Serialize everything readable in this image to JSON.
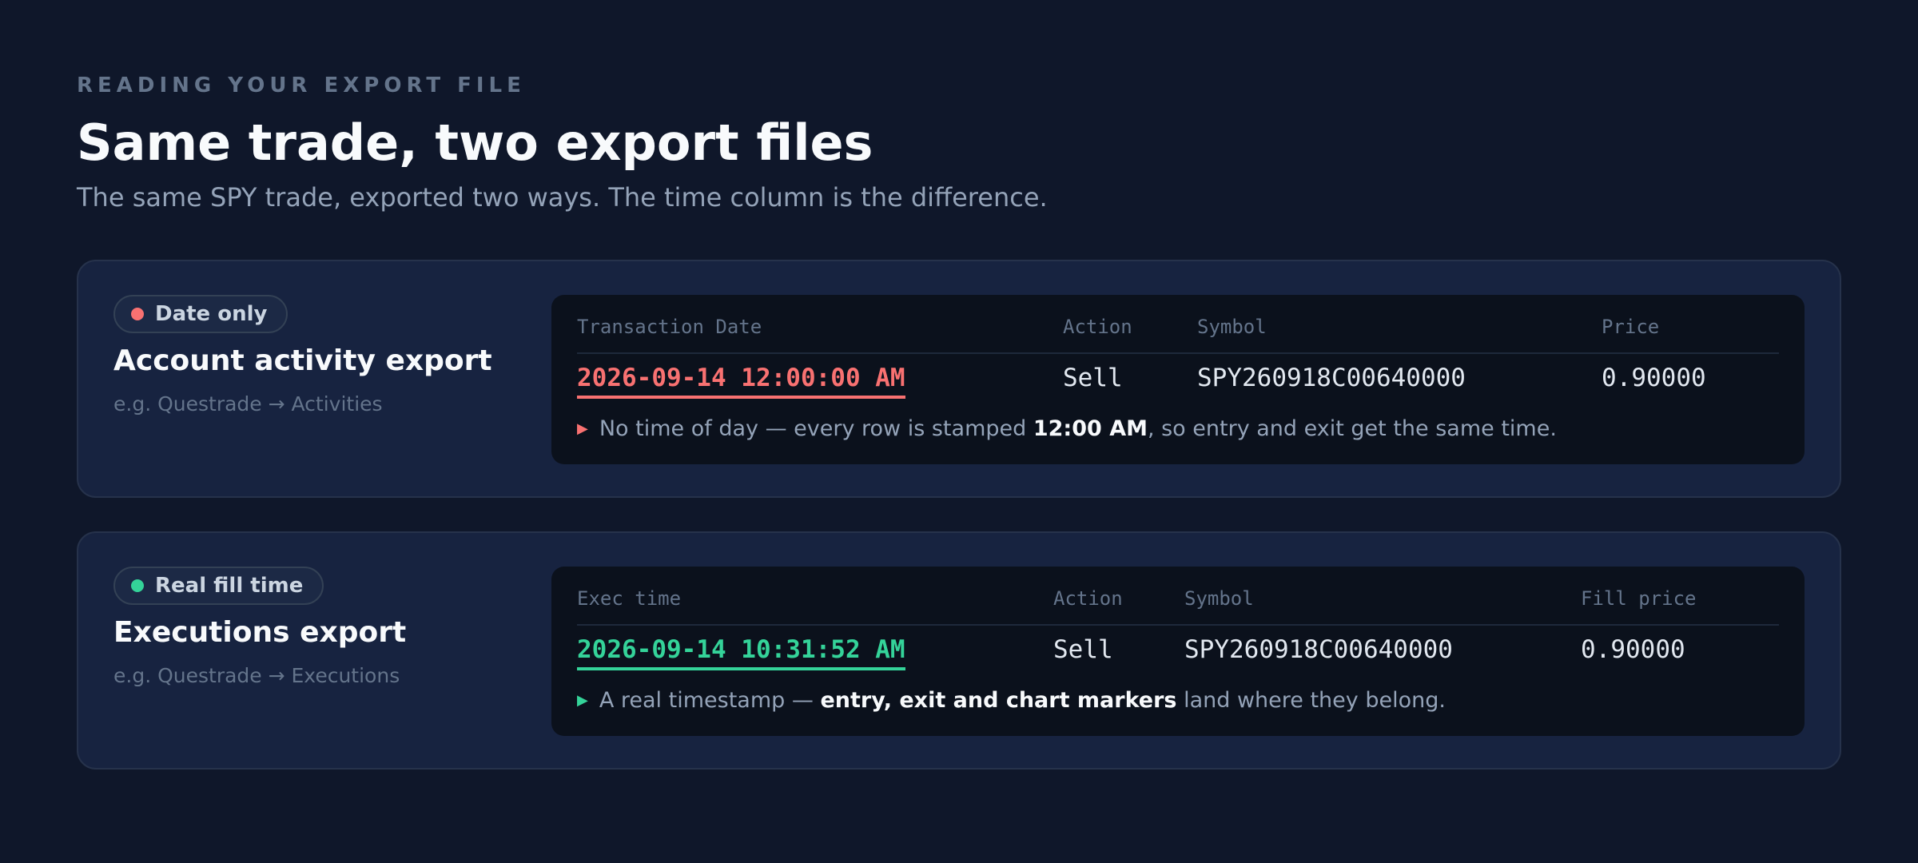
{
  "header": {
    "eyebrow": "READING YOUR EXPORT FILE",
    "title": "Same trade, two export files",
    "subtitle": "The same SPY trade, exported two ways. The time column is the difference."
  },
  "colors": {
    "bad": "#f87171",
    "good": "#34d399"
  },
  "cards": [
    {
      "badge": "Date only",
      "title": "Account activity export",
      "subtitle": "e.g. Questrade → Activities",
      "columns": [
        "Transaction Date",
        "Action",
        "Symbol",
        "Price"
      ],
      "row": [
        "2026-09-14 12:00:00 AM",
        "Sell",
        "SPY260918C00640000",
        "0.90000"
      ],
      "note": {
        "pre": "No time of day — every row is stamped ",
        "bold": "12:00 AM",
        "post": ", so entry and exit get the same time."
      }
    },
    {
      "badge": "Real fill time",
      "title": "Executions export",
      "subtitle": "e.g. Questrade → Executions",
      "columns": [
        "Exec time",
        "Action",
        "Symbol",
        "Fill price"
      ],
      "row": [
        "2026-09-14 10:31:52 AM",
        "Sell",
        "SPY260918C00640000",
        "0.90000"
      ],
      "note": {
        "pre": "A real timestamp — ",
        "bold": "entry, exit and chart markers",
        "post": " land where they belong."
      }
    }
  ]
}
